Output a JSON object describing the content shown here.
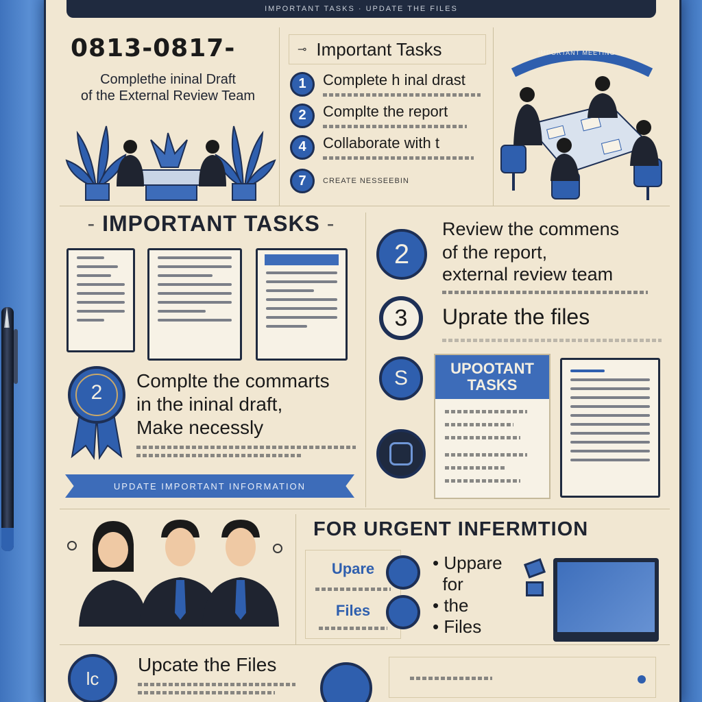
{
  "banner": {
    "text": "IMPORTANT TASKS · UPDATE THE FILES"
  },
  "top_left": {
    "date_range": "0813-0817-",
    "subtitle_line1": "Complethe ininal Draft",
    "subtitle_line2": "of the External Review Team"
  },
  "top_right": {
    "heading": "Important Tasks",
    "tasks": [
      {
        "number": "1",
        "text": "Complete h inal drast"
      },
      {
        "number": "2",
        "text": "Complte the report"
      },
      {
        "number": "4",
        "text": "Collaborate with t"
      },
      {
        "number": "7",
        "text": "CREATE NESSEEBIN"
      }
    ],
    "badge_text": "IMPORTANT MEETING"
  },
  "middle_left": {
    "heading": "IMPORTANT TASKS",
    "ribbon_number": "2",
    "ribbon_text_line1": "Complte the commarts",
    "ribbon_text_line2": "in the ininal draft,",
    "ribbon_text_line3": "Make necessly",
    "banner_text": "UPDATE IMPORTANT INFORMATION"
  },
  "middle_right": {
    "item1_number": "2",
    "item1_line1": "Review the commens",
    "item1_line2": "of the report,",
    "item1_line3": "external  review team",
    "item2_number": "3",
    "item2_text": "Uprate the files",
    "item3_number": "S",
    "card_heading_line1": "UPOOTANT",
    "card_heading_line2": "TASKS"
  },
  "bottom_right": {
    "heading": "FOR URGENT INFERMTION",
    "label_top": "Uparе",
    "label_bottom": "Files",
    "bullets": [
      "Uppare",
      "for",
      "the",
      "Files"
    ]
  },
  "bottom_left": {
    "number": "lc",
    "text": "Upcate the Files"
  },
  "colors": {
    "accent_blue": "#2f5fae",
    "navy": "#1d2f55",
    "paper": "#f1e7d2"
  }
}
